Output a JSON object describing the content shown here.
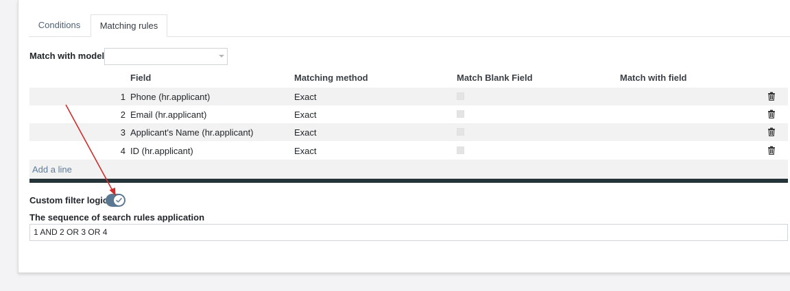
{
  "tabs": [
    {
      "label": "Conditions",
      "active": false
    },
    {
      "label": "Matching rules",
      "active": true
    }
  ],
  "match_model": {
    "label": "Match with model",
    "value": ""
  },
  "table": {
    "headers": {
      "field": "Field",
      "method": "Matching method",
      "blank": "Match Blank Field",
      "with_field": "Match with field"
    },
    "rows": [
      {
        "num": "1",
        "field": "Phone (hr.applicant)",
        "method": "Exact",
        "match_blank": false
      },
      {
        "num": "2",
        "field": "Email (hr.applicant)",
        "method": "Exact",
        "match_blank": false
      },
      {
        "num": "3",
        "field": "Applicant's Name (hr.applicant)",
        "method": "Exact",
        "match_blank": false
      },
      {
        "num": "4",
        "field": "ID (hr.applicant)",
        "method": "Exact",
        "match_blank": false
      }
    ],
    "add_line": "Add a line"
  },
  "custom_filter": {
    "label": "Custom filter logic",
    "enabled": true
  },
  "sequence": {
    "label": "The sequence of search rules application",
    "value": "1 AND 2 OR 3 OR 4"
  },
  "colors": {
    "toggle": "#5b7892",
    "dark_bar": "#243438",
    "annotation_arrow": "#d42a2a",
    "link": "#5d7b99"
  }
}
